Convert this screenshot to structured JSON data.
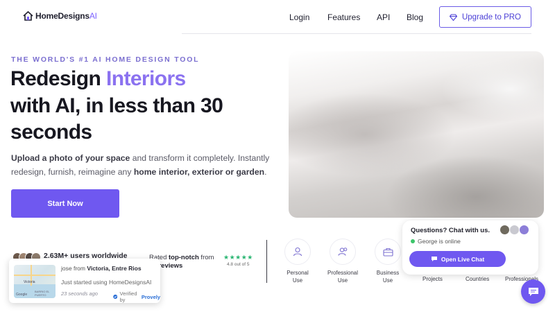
{
  "header": {
    "logo": {
      "name_main": "HomeDesigns",
      "name_suffix": "AI"
    },
    "nav": [
      "Login",
      "Features",
      "API",
      "Blog"
    ],
    "upgrade_label": "Upgrade to PRO"
  },
  "hero": {
    "eyebrow": "THE WORLD'S #1 AI HOME DESIGN TOOL",
    "headline_part1": "Redesign",
    "headline_accent": "Interiors",
    "headline_line2": "with AI, in less than 30",
    "headline_line3": "seconds",
    "sub_bold1": "Upload a photo of your space",
    "sub_text1": " and transform it completely. Instantly",
    "sub_text2": "redesign, furnish, reimagine any ",
    "sub_bold2": "home interior, exterior or garden",
    "sub_text3": ".",
    "cta_label": "Start Now"
  },
  "stats": {
    "users": "2.63M+ users worldwide",
    "rated_prefix": "Rated ",
    "rated_bold": "top-notch",
    "rated_suffix": " from",
    "reviews": "0+ reviews",
    "stars": "★★★★★",
    "rating_text": "4.8 out of 5",
    "rating_value": 4.8
  },
  "use_cases": [
    {
      "line1": "Personal",
      "line2": "Use",
      "icon": "person-icon"
    },
    {
      "line1": "Professional",
      "line2": "Use",
      "icon": "users-icon"
    },
    {
      "line1": "Business",
      "line2": "Use",
      "icon": "briefcase-icon"
    }
  ],
  "partial_labels": [
    "Projects",
    "Countries",
    "Professionals"
  ],
  "chat": {
    "title": "Questions? Chat with us.",
    "status": "George is online",
    "button": "Open Live Chat"
  },
  "notification": {
    "name": "jose from ",
    "place": "Victoria, Entre Rios",
    "action": "Just started using HomeDesignsAI",
    "time": "23 seconds ago",
    "verified_prefix": "Verified by ",
    "verified_brand": "Provely",
    "map_label1": "Victoria",
    "map_label2": "BARRIO EL PUERTO",
    "map_label3": "Google"
  },
  "colors": {
    "accent": "#6f58f0",
    "accent_text": "#8b72f0",
    "online": "#3cc56a",
    "stars": "#2bb673"
  }
}
